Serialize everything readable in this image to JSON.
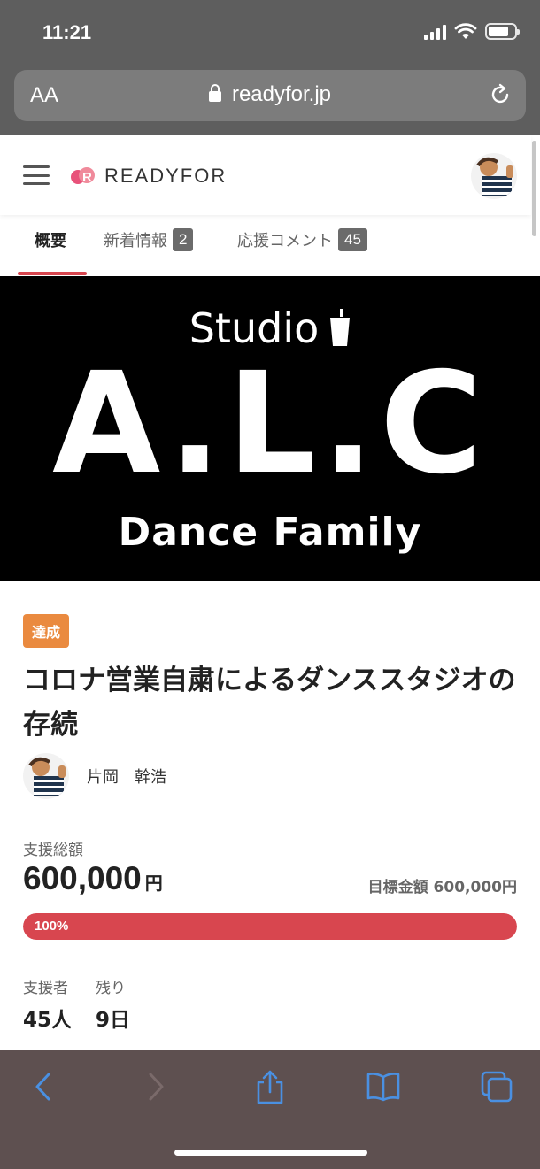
{
  "status_bar": {
    "time": "11:21"
  },
  "browser": {
    "text_size_label": "AA",
    "url": "readyfor.jp"
  },
  "header": {
    "logo_text": "READYFOR"
  },
  "tabs": [
    {
      "label": "概要"
    },
    {
      "label": "新着情報",
      "badge": "2"
    },
    {
      "label": "応援コメント",
      "badge": "45"
    }
  ],
  "hero": {
    "line1": "Studio",
    "line2": "A.L.C",
    "line3": "Dance Family"
  },
  "project": {
    "badge": "達成",
    "title": "コロナ営業自粛によるダンススタジオの存続",
    "owner_name": "片岡　幹浩"
  },
  "funding": {
    "total_label": "支援総額",
    "total_amount": "600,000",
    "total_unit": "円",
    "target_text": "目標金額 600,000円",
    "progress_text": "100%",
    "progress_percent": 100
  },
  "stats": {
    "supporters_label": "支援者",
    "supporters_value": "45人",
    "remaining_label": "残り",
    "remaining_value": "9日"
  },
  "colors": {
    "accent": "#d8464f",
    "badge_orange": "#ea8a3f",
    "toolbar_icon": "#4a90e2"
  },
  "icons": [
    "lock-icon",
    "reload-icon",
    "menu-icon",
    "back-icon",
    "forward-icon",
    "share-icon",
    "bookmarks-icon",
    "tabs-icon"
  ]
}
